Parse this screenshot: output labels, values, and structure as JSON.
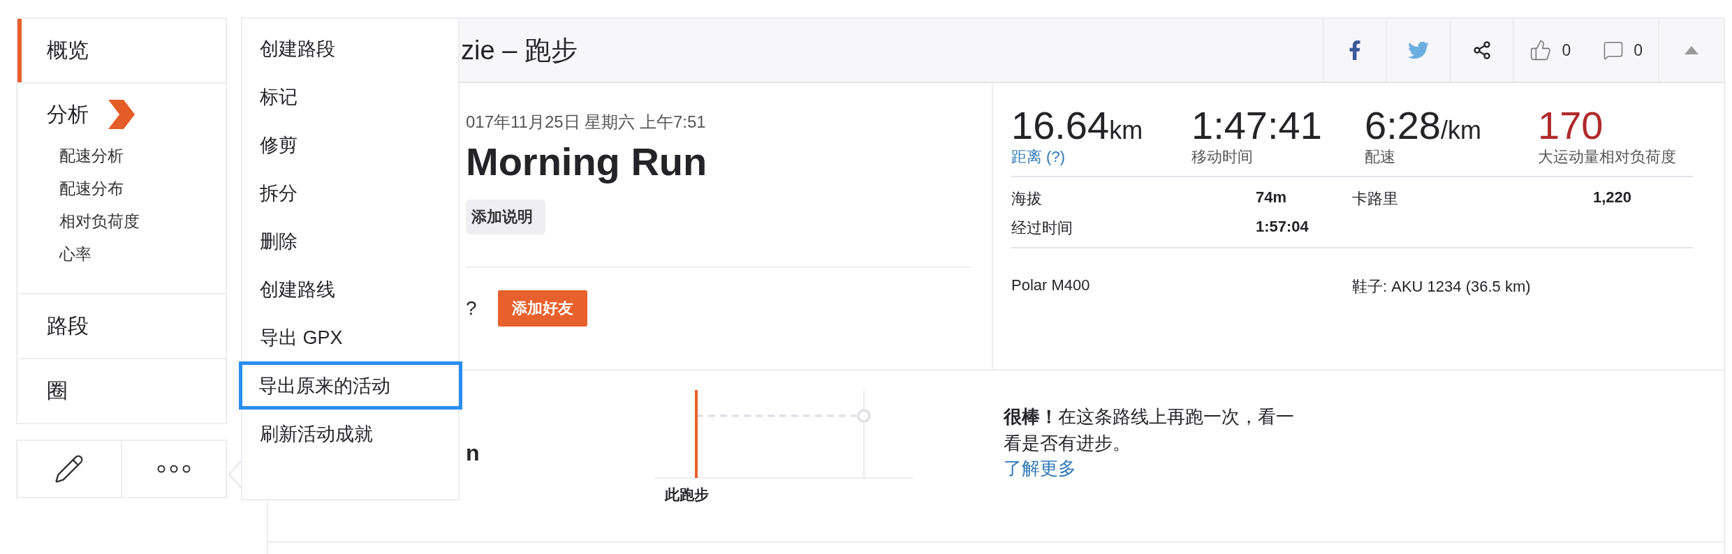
{
  "sidebar": {
    "items": [
      {
        "label": "概览",
        "selected": true,
        "kind": "section"
      },
      {
        "label": "分析",
        "selected": false,
        "kind": "group",
        "children": [
          {
            "label": "配速分析"
          },
          {
            "label": "配速分布"
          },
          {
            "label": "相对负荷度"
          },
          {
            "label": "心率"
          }
        ]
      },
      {
        "label": "路段",
        "selected": false,
        "kind": "section"
      },
      {
        "label": "圈",
        "selected": false,
        "kind": "section"
      }
    ]
  },
  "menu": {
    "items": [
      {
        "label": "创建路段",
        "selected": false
      },
      {
        "label": "标记",
        "selected": false
      },
      {
        "label": "修剪",
        "selected": false
      },
      {
        "label": "拆分",
        "selected": false
      },
      {
        "label": "删除",
        "selected": false
      },
      {
        "label": "创建路线",
        "selected": false
      },
      {
        "label": "导出 GPX",
        "selected": false
      },
      {
        "label": "导出原来的活动",
        "selected": true
      },
      {
        "label": "刷新活动成就",
        "selected": false
      }
    ]
  },
  "header": {
    "title": "zie – 跑步",
    "likes": "0",
    "comments": "0"
  },
  "activity": {
    "date": "017年11月25日 星期六 上午7:51",
    "name": "Morning Run",
    "add_description": "添加说明",
    "question": "?",
    "add_friend": "添加好友"
  },
  "stats": [
    {
      "kind": "distance",
      "value": "16.64",
      "unit": "km",
      "label": "距离 (?)"
    },
    {
      "kind": "plain",
      "value": "1:47:41",
      "label": "移动时间"
    },
    {
      "kind": "plain",
      "value": "6:28",
      "unit": "/km",
      "label": "配速"
    },
    {
      "kind": "effort",
      "value": "170",
      "label": "大运动量相对负荷度"
    }
  ],
  "details": [
    [
      {
        "label": "海拔",
        "value": "74m"
      },
      {
        "label": "经过时间",
        "value": "1:57:04"
      }
    ],
    [
      {
        "label": "卡路里",
        "value": "1,220"
      }
    ]
  ],
  "gear": {
    "device": "Polar M400",
    "shoes": "鞋子: AKU 1234 (36.5 km)"
  },
  "segment": {
    "partial_title": "n",
    "caption": "此跑步",
    "prompt": "**很棒！**在这条路线上再跑一次，看一看是否有进步。",
    "link": "了解更多"
  }
}
